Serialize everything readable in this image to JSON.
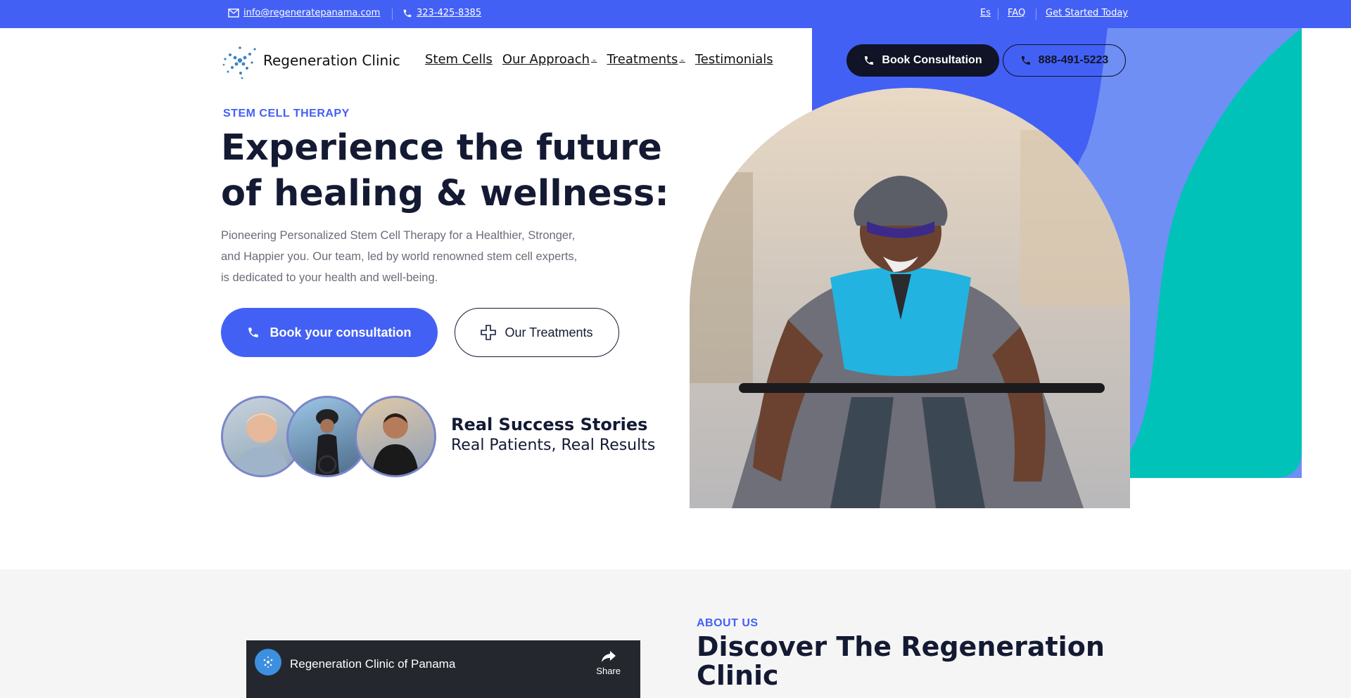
{
  "topbar": {
    "email": "info@regeneratepanama.com",
    "phone": "323-425-8385",
    "lang": "Es",
    "faq": "FAQ",
    "get_started": "Get Started Today"
  },
  "header": {
    "logo_text": "Regeneration Clinic",
    "nav": [
      {
        "label": "Stem Cells",
        "has_dropdown": false
      },
      {
        "label": "Our Approach",
        "has_dropdown": true
      },
      {
        "label": "Treatments",
        "has_dropdown": true
      },
      {
        "label": "Testimonials",
        "has_dropdown": false
      }
    ],
    "book_button": "Book Consultation",
    "phone_button": "888-491-5223"
  },
  "hero": {
    "eyebrow": "STEM CELL THERAPY",
    "title": "Experience the future of healing & wellness:",
    "description": "Pioneering Personalized Stem Cell Therapy for a Healthier, Stronger, and Happier you. Our team, led by world renowned stem cell experts, is dedicated to your health and well-being.",
    "book_button": "Book your consultation",
    "treatments_button": "Our Treatments",
    "success_title": "Real Success Stories",
    "success_sub": "Real Patients, Real Results"
  },
  "about": {
    "eyebrow": "ABOUT US",
    "title": "Discover The Regeneration Clinic",
    "video_title": "Regeneration Clinic of Panama",
    "video_share": "Share"
  },
  "colors": {
    "accent": "#4360f5",
    "dark": "#141a33",
    "teal": "#00c2b8",
    "light_blue": "#6f8ff5"
  }
}
